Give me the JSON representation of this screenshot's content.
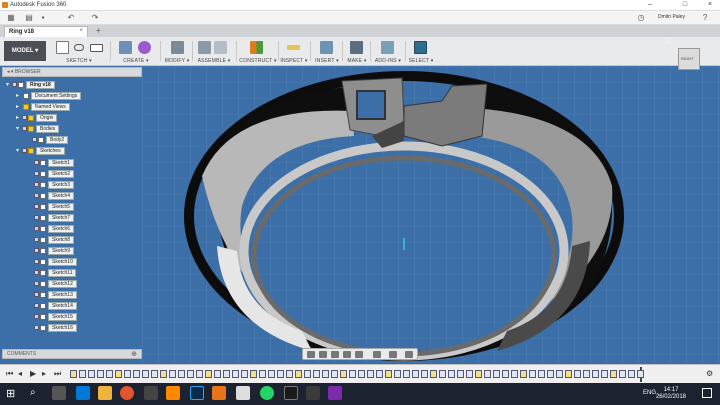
{
  "window": {
    "title": "Autodesk Fusion 360"
  },
  "appbar": {
    "user": "Dmitri Paley",
    "icons": [
      "grid-icon",
      "file-icon",
      "save-icon",
      "undo-icon",
      "redo-icon",
      "clock-icon",
      "help-icon"
    ]
  },
  "tabbar": {
    "document": "Ring v18",
    "add": "+"
  },
  "toolbar": {
    "workspace": "MODEL ▾",
    "groups": [
      "SKETCH ▾",
      "CREATE ▾",
      "MODIFY ▾",
      "ASSEMBLE ▾",
      "CONSTRUCT ▾",
      "INSPECT ▾",
      "INSERT ▾",
      "MAKE ▾",
      "ADD-INS ▾",
      "SELECT ▾"
    ]
  },
  "browser": {
    "header": "BROWSER",
    "root": "Ring v18",
    "items": [
      "Document Settings",
      "Named Views",
      "Origin",
      "Bodies",
      "Body2",
      "Sketches"
    ],
    "sketches": [
      "Sketch1",
      "Sketch2",
      "Sketch3",
      "Sketch4",
      "Sketch5",
      "Sketch7",
      "Sketch6",
      "Sketch8",
      "Sketch9",
      "Sketch10",
      "Sketch11",
      "Sketch12",
      "Sketch13",
      "Sketch14",
      "Sketch15",
      "Sketch16"
    ]
  },
  "comments": {
    "label": "COMMENTS"
  },
  "viewcube": {
    "label": "RIGHT"
  },
  "taskbar": {
    "lang": "ENG",
    "time": "14:17",
    "date": "26/02/2018"
  },
  "colors": {
    "canvas": "#3c6fa8",
    "grid": "#5684b8",
    "toolbar": "#e8eaec",
    "browserPanel": "#d7d9dc"
  }
}
